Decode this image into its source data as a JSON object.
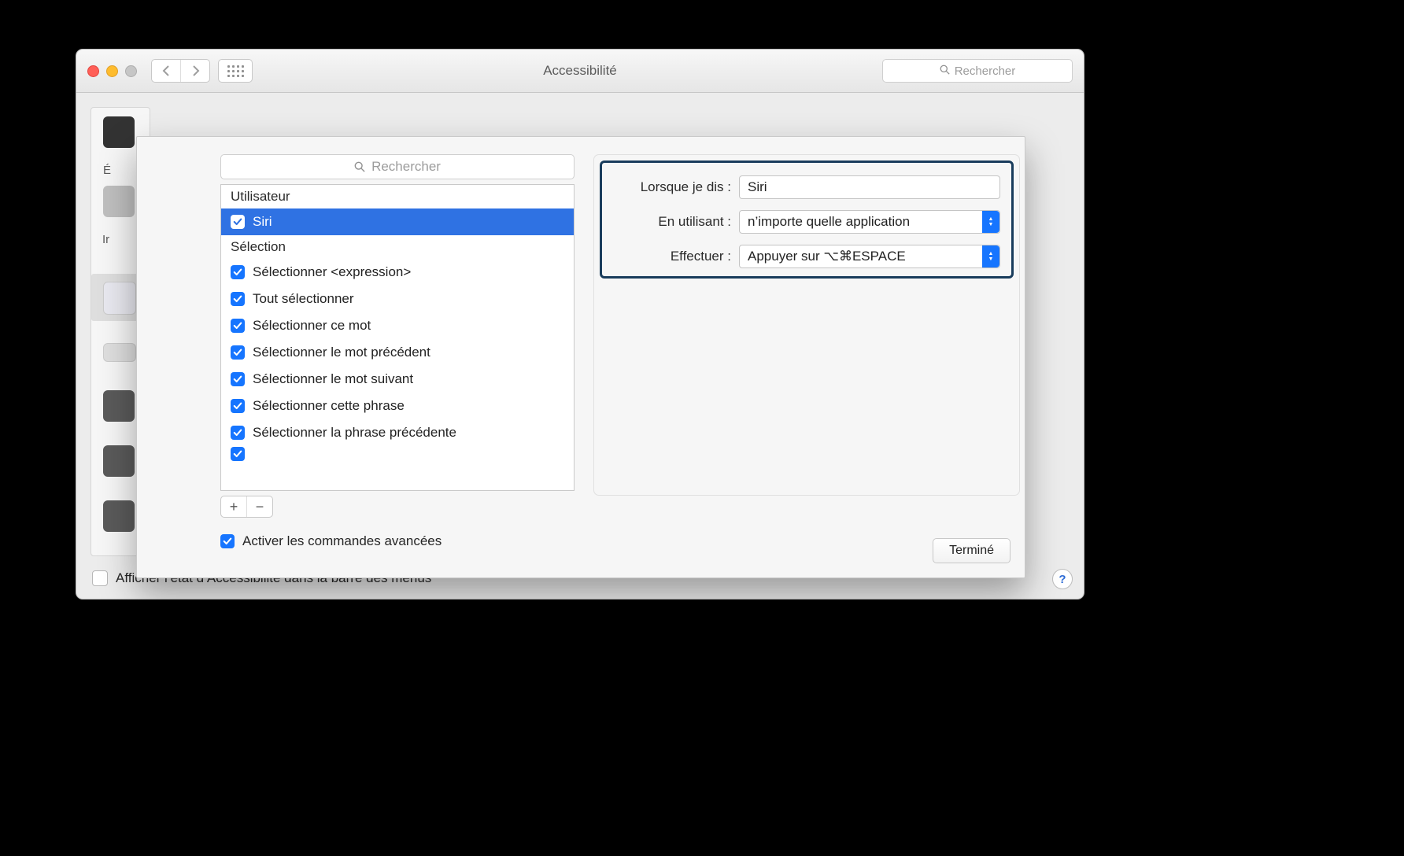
{
  "window": {
    "title": "Accessibilité",
    "toolbar_search_placeholder": "Rechercher"
  },
  "sheet": {
    "search_placeholder": "Rechercher",
    "groups": {
      "user_label": "Utilisateur",
      "selection_label": "Sélection"
    },
    "user_items": [
      {
        "checked": true,
        "selected": true,
        "label": "Siri"
      }
    ],
    "selection_items": [
      {
        "checked": true,
        "label": "Sélectionner <expression>"
      },
      {
        "checked": true,
        "label": "Tout sélectionner"
      },
      {
        "checked": true,
        "label": "Sélectionner ce mot"
      },
      {
        "checked": true,
        "label": "Sélectionner le mot précédent"
      },
      {
        "checked": true,
        "label": "Sélectionner le mot suivant"
      },
      {
        "checked": true,
        "label": "Sélectionner cette phrase"
      },
      {
        "checked": true,
        "label": "Sélectionner la phrase précédente"
      }
    ],
    "add_label": "+",
    "remove_label": "−",
    "advanced_checkbox_label": "Activer les commandes avancées",
    "advanced_checked": true,
    "done_label": "Terminé"
  },
  "detail": {
    "when_i_say_label": "Lorsque je dis :",
    "when_i_say_value": "Siri",
    "using_label": "En utilisant :",
    "using_value": "n’importe quelle application",
    "perform_label": "Effectuer :",
    "perform_value": "Appuyer sur ⌥⌘ESPACE"
  },
  "background": {
    "menubar_checkbox_label": "Afficher l’état d’Accessibilité dans la barre des menus",
    "menubar_checked": false,
    "help_label": "?",
    "sidebar_partial_label": "É",
    "sidebar_partial_label2": "Ir"
  }
}
